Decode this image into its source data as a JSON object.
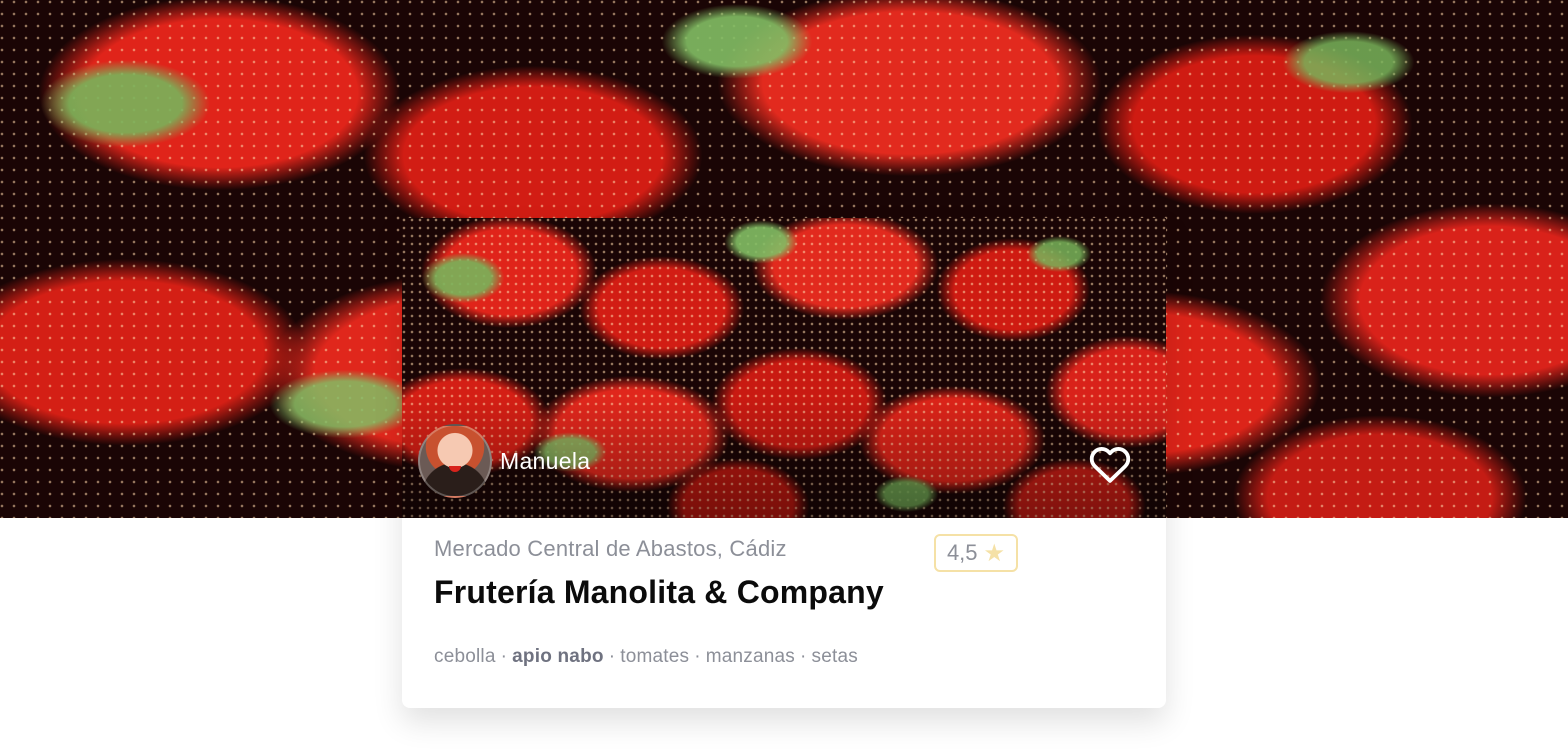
{
  "hero": {
    "image": "strawberries-photo"
  },
  "card": {
    "image": "strawberries-photo",
    "owner": {
      "name": "Manuela",
      "avatar": "user-avatar"
    },
    "favorite_icon": "heart-outline-icon",
    "location": "Mercado Central de Abastos, Cádiz",
    "rating": {
      "value": "4,5",
      "icon": "star-icon",
      "color": "#f5e1a6"
    },
    "title": "Frutería Manolita & Company",
    "tags": [
      {
        "label": "cebolla",
        "bold": false
      },
      {
        "label": "apio nabo",
        "bold": true
      },
      {
        "label": "tomates",
        "bold": false
      },
      {
        "label": "manzanas",
        "bold": false
      },
      {
        "label": "setas",
        "bold": false
      }
    ],
    "tag_separator": "·"
  }
}
